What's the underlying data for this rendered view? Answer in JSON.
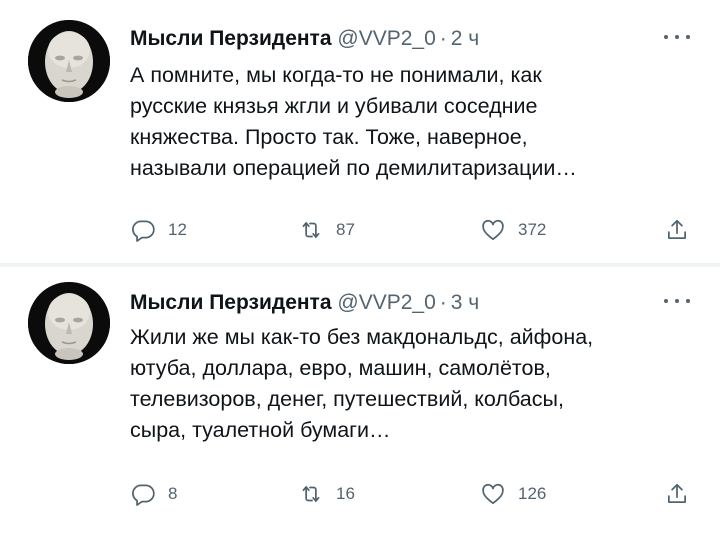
{
  "tweets": [
    {
      "author": {
        "name": "Мысли Перзидента",
        "handle": "@VVP2_0",
        "time": "2 ч"
      },
      "separator": "·",
      "lines": [
        "А помните, мы когда-то не понимали, как",
        "русские князья жгли и убивали соседние",
        "княжества. Просто так. Тоже, наверное,",
        "называли операцией по демилитаризации…"
      ],
      "stats": {
        "replies": "12",
        "retweets": "87",
        "likes": "372"
      }
    },
    {
      "author": {
        "name": "Мысли Перзидента",
        "handle": "@VVP2_0",
        "time": "3 ч"
      },
      "separator": "·",
      "lines": [
        "Жили же мы как-то без макдональдс, айфона,",
        "ютуба, доллара, евро, машин, самолётов,",
        "телевизоров, денег, путешествий, колбасы,",
        "сыра, туалетной бумаги…"
      ],
      "stats": {
        "replies": "8",
        "retweets": "16",
        "likes": "126"
      }
    }
  ],
  "icons": {
    "reply": "reply-icon",
    "retweet": "retweet-icon",
    "like": "heart-icon",
    "share": "share-icon",
    "more": "more-icon"
  },
  "colors": {
    "text": "#0f1419",
    "secondary": "#536471",
    "divider": "#eff3f4"
  }
}
